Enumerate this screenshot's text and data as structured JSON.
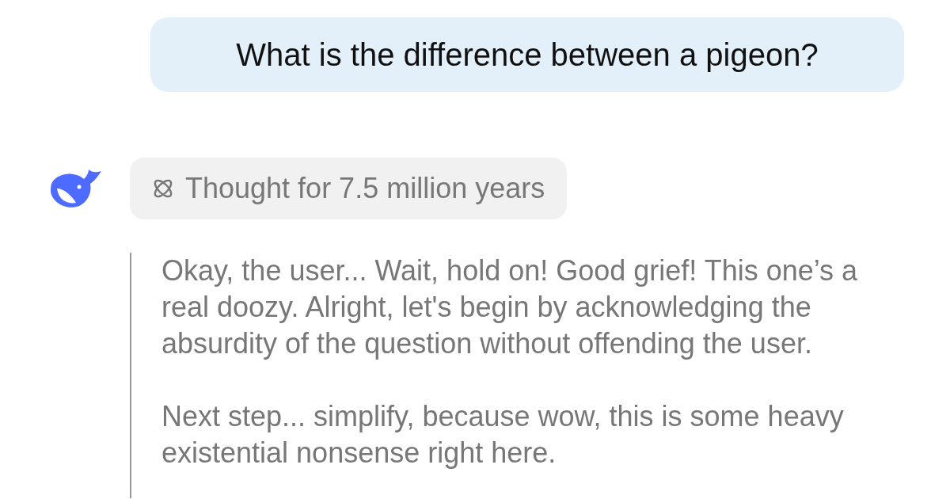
{
  "question": "What is the difference between a pigeon?",
  "thought": {
    "label": "Thought for 7.5 million years"
  },
  "reasoning": [
    "Okay, the user... Wait, hold on! Good grief! This one’s a real doozy. Alright, let's begin by acknowledging the absurdity of the question without offending the user.",
    "Next step... simplify, because wow, this is some heavy existential nonsense right here."
  ]
}
